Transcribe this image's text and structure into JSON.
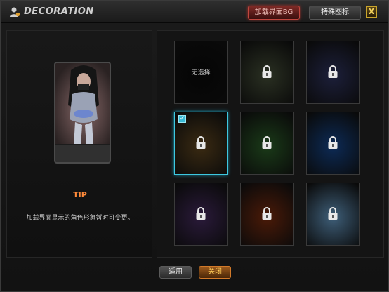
{
  "window": {
    "title": "DECORATION",
    "tabs": [
      {
        "label": "加载界面BG",
        "active": true
      },
      {
        "label": "特殊图标",
        "active": false
      }
    ],
    "close_label": "X"
  },
  "preview": {
    "tip_title": "TIP",
    "tip_text": "加载界面显示的角色形象暂时可变更。"
  },
  "grid": {
    "none_label": "无选择",
    "tiles": [
      {
        "id": "none",
        "locked": false,
        "selected": false,
        "bg": "#050505"
      },
      {
        "id": "camo-green",
        "locked": true,
        "selected": false,
        "bg": "#2a3022"
      },
      {
        "id": "camo-navy",
        "locked": true,
        "selected": false,
        "bg": "#1c1f3a"
      },
      {
        "id": "brown-glow",
        "locked": true,
        "selected": true,
        "bg": "#3a2a12"
      },
      {
        "id": "green-nebula",
        "locked": true,
        "selected": false,
        "bg": "#1a3a18"
      },
      {
        "id": "blue-nebula",
        "locked": true,
        "selected": false,
        "bg": "#0c2a55"
      },
      {
        "id": "purple-space",
        "locked": true,
        "selected": false,
        "bg": "#2a1a3a"
      },
      {
        "id": "fire",
        "locked": true,
        "selected": false,
        "bg": "#4a1a08"
      },
      {
        "id": "frost",
        "locked": true,
        "selected": false,
        "bg": "#3e5e78"
      }
    ]
  },
  "footer": {
    "apply_label": "适用",
    "close_label": "关闭"
  },
  "colors": {
    "accent_red": "#c0463e",
    "accent_orange": "#ff8a3a",
    "select_cyan": "#3ec8e0"
  }
}
